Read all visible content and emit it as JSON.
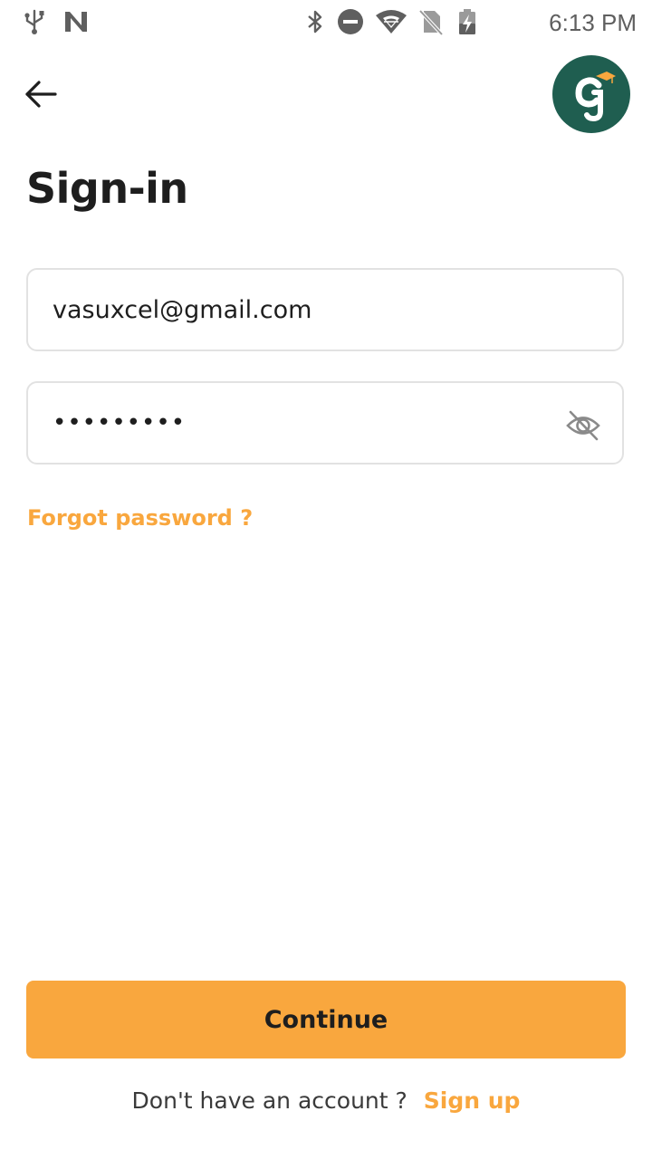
{
  "status_bar": {
    "time": "6:13 PM",
    "left_icons": [
      "usb-icon",
      "n-notification-icon"
    ],
    "right_icons": [
      "bluetooth-icon",
      "do-not-disturb-icon",
      "wifi-icon",
      "no-sim-icon",
      "battery-charging-icon"
    ]
  },
  "header": {
    "back_icon": "arrow-left-icon",
    "avatar_letter": "G",
    "title": "Sign-in"
  },
  "form": {
    "email_value": "vasuxcel@gmail.com",
    "password_value": "•••••••••",
    "password_toggle_icon": "eye-off-icon",
    "forgot_label": "Forgot password ?"
  },
  "footer": {
    "continue_label": "Continue",
    "signup_prompt": "Don't have an account ?",
    "signup_label": "Sign up"
  },
  "colors": {
    "accent": "#f9a73e",
    "avatar_bg": "#1f5e50",
    "text_dark": "#1e1e1e"
  }
}
